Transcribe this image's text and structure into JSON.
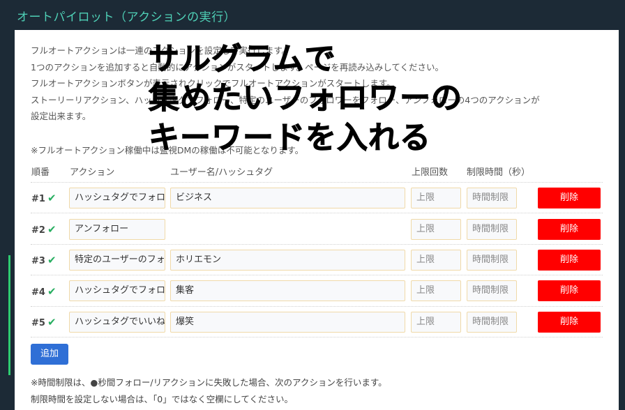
{
  "header": {
    "title": "オートパイロット（アクションの実行）"
  },
  "description": {
    "lines": [
      "フルオートアクションは一連のアクションを設定して実行します。",
      "1つのアクションを追加すると自動的にアクションがスタートします。ページを再読み込みしてください。",
      "フルオートアクションボタンが表示されクリックでフルオートアクションがスタートします。",
      "ストーリーリアクション、ハッシュタグでフォロー、特定のユーザーのフォロワーをフォロー、アンフォローの4つのアクションが",
      "設定出来ます。",
      "※フルオートアクション稼働中は監視DMの稼働は不可能となります。"
    ]
  },
  "overlay": {
    "lines": [
      "サルグラムで",
      "集めたいフォロワーの",
      "キーワードを入れる"
    ]
  },
  "table": {
    "headers": {
      "order": "順番",
      "action": "アクション",
      "username": "ユーザー名/ハッシュタグ",
      "limit": "上限回数",
      "time_limit": "制限時間（秒）"
    },
    "rows": [
      {
        "num": "#1",
        "action": "ハッシュタグでフォロー",
        "target": "ビジネス",
        "limit_ph": "上限",
        "time_ph": "時間制限",
        "delete": "削除"
      },
      {
        "num": "#2",
        "action": "アンフォロー",
        "target": "",
        "limit_ph": "上限",
        "time_ph": "時間制限",
        "delete": "削除"
      },
      {
        "num": "#3",
        "action": "特定のユーザーのフォロワーをフォロー",
        "target": "ホリエモン",
        "limit_ph": "上限",
        "time_ph": "時間制限",
        "delete": "削除"
      },
      {
        "num": "#4",
        "action": "ハッシュタグでフォロー",
        "target": "集客",
        "limit_ph": "上限",
        "time_ph": "時間制限",
        "delete": "削除"
      },
      {
        "num": "#5",
        "action": "ハッシュタグでいいね",
        "target": "爆笑",
        "limit_ph": "上限",
        "time_ph": "時間制限",
        "delete": "削除"
      }
    ]
  },
  "buttons": {
    "add_label": "追加"
  },
  "notes": {
    "line1": "※時間制限は、●秒間フォロー/リアクションに失敗した場合、次のアクションを行います。",
    "line2": "制限時間を設定しない場合は、「0」ではなく空欄にしてください。"
  },
  "icons": {
    "check": "check-icon"
  },
  "colors": {
    "accent": "#4fd1b7",
    "delete": "#ff0000",
    "add": "#2f6fd6",
    "check": "#27ae60"
  }
}
